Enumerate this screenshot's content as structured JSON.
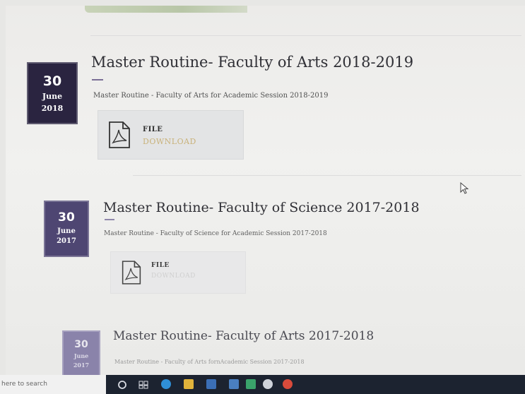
{
  "posts": [
    {
      "date": {
        "day": "30",
        "month": "June",
        "year": "2018"
      },
      "title": "Master Routine- Faculty of Arts 2018-2019",
      "description": "Master Routine - Faculty of Arts for Academic Session 2018-2019",
      "file_label": "FILE",
      "download_label": "DOWNLOAD"
    },
    {
      "date": {
        "day": "30",
        "month": "June",
        "year": "2017"
      },
      "title": "Master Routine- Faculty of Science 2017-2018",
      "description": "Master Routine - Faculty of Science for Academic Session 2017-2018",
      "file_label": "FILE",
      "download_label": "DOWNLOAD"
    },
    {
      "date": {
        "day": "30",
        "month": "June",
        "year": "2017"
      },
      "title": "Master Routine- Faculty of Arts 2017-2018",
      "description": "Master Routine - Faculty of Arts fornAcademic Session 2017-2018"
    }
  ],
  "taskbar": {
    "search_placeholder": "here to search"
  },
  "colors": {
    "badge_dark": "#2a2440",
    "badge_mid": "#4e4672",
    "badge_light": "#7a72a0",
    "download": "#c9b27a",
    "taskbar": "#1c2330"
  }
}
